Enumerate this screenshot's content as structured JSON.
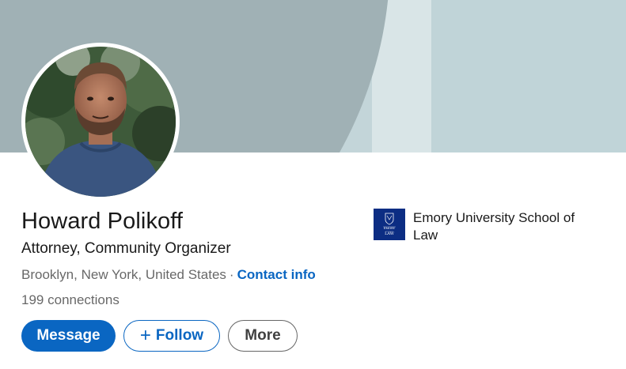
{
  "profile": {
    "name": "Howard Polikoff",
    "headline": "Attorney, Community Organizer",
    "location": "Brooklyn, New York, United States",
    "separator": "·",
    "contact_link": "Contact info",
    "connections_count": "199",
    "connections_label": "connections",
    "avatar_icon": "profile-photo"
  },
  "actions": {
    "message_label": "Message",
    "follow_label": "Follow",
    "follow_icon": "+",
    "more_label": "More"
  },
  "education": {
    "school": "Emory University School of Law",
    "logo_lines": [
      "EMORY",
      "LAW"
    ]
  },
  "colors": {
    "primary": "#0a66c2",
    "logo_bg": "#0c2d83",
    "cover_gray": "#a0b1b5",
    "cover_light": "#c0d4d8"
  }
}
